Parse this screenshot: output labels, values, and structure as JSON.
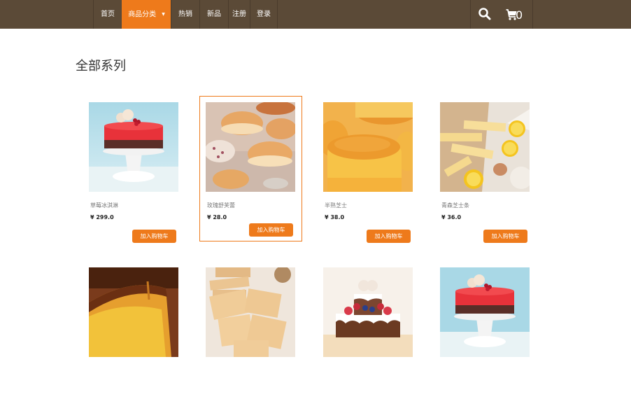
{
  "nav": {
    "items": [
      {
        "label": "首页"
      },
      {
        "label": "商品分类",
        "active": true
      },
      {
        "label": "热销"
      },
      {
        "label": "新品"
      },
      {
        "label": "注册"
      },
      {
        "label": "登录"
      }
    ],
    "search_icon": "search-icon",
    "cart_icon": "cart-icon",
    "cart_count": "0",
    "colors": {
      "bar": "#5b4a37",
      "accent": "#ee7a1b"
    }
  },
  "main": {
    "title": "全部系列",
    "products": [
      {
        "name": "草莓冰淇淋",
        "price": "¥ 299.0",
        "button": "加入购物车"
      },
      {
        "name": "玫瑰舒芙蕾",
        "price": "¥ 28.0",
        "button": "加入购物车"
      },
      {
        "name": "半熟芝士",
        "price": "¥ 38.0",
        "button": "加入购物车"
      },
      {
        "name": "青森芝士条",
        "price": "¥ 36.0",
        "button": "加入购物车"
      }
    ]
  }
}
